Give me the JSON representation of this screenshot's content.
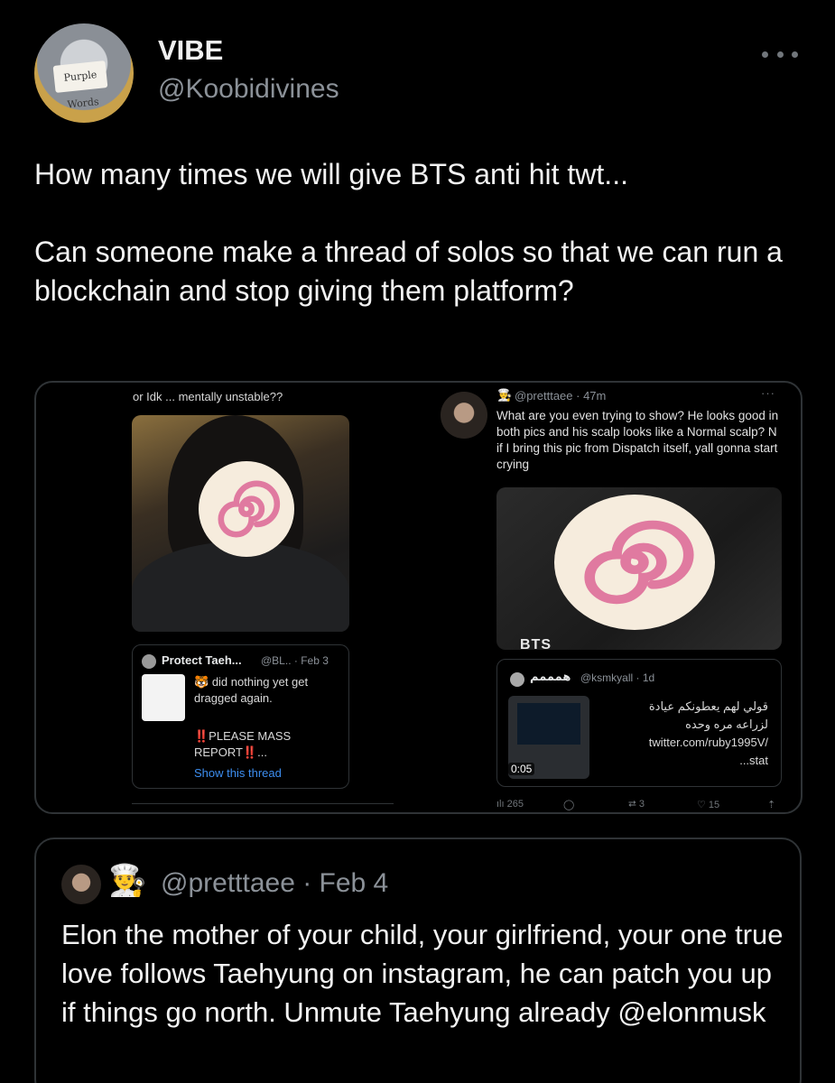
{
  "author": {
    "display_name": "VIBE",
    "handle": "@Koobidivines",
    "avatar_sign_text": "Purple Words"
  },
  "tweet": {
    "paragraph_1": "How many times we will give BTS anti hit twt...",
    "paragraph_2": "Can someone make a thread of solos so that we can run a blockchain and stop giving them platform?"
  },
  "media": {
    "left_caption": "or Idk ... mentally unstable??",
    "left_quote": {
      "name": "Protect Taeh...",
      "meta": "@BL.. · Feb 3",
      "emoji": "🐯",
      "text_1": "did nothing yet get dragged again.",
      "text_2": "‼️PLEASE MASS REPORT‼️...",
      "link": "Show this thread"
    },
    "reply": {
      "chef_icon": "👨‍🍳",
      "handle": "@pretttaee · 47m",
      "more": "···",
      "text": "What are you even trying to show? He looks good in both pics and his scalp looks like a Normal scalp? N if I bring this pic from Dispatch itself, yall gonna start crying",
      "photo_label": "BTS"
    },
    "right_quote": {
      "name": "همممم",
      "meta": "@ksmkyall · 1d",
      "text_line1": "قولي لهم يعطونكم عيادة",
      "text_line2": "لزراعه مره وحده",
      "text_line3": "twitter.com/ruby1995V/",
      "text_line4": "...stat",
      "duration": "0:05"
    },
    "actions": {
      "views": "ılı 265",
      "reply": "◯",
      "retweet": "⮂ 3",
      "like": "♡ 15",
      "share": "⇡"
    }
  },
  "quoted_tweet": {
    "chef_icon": "👨‍🍳",
    "handle": "@pretttaee · Feb 4",
    "text": "Elon the mother of your child, your girlfriend, your one true love follows Taehyung on instagram, he can patch you up if things go north. Unmute Taehyung already @elonmusk"
  }
}
